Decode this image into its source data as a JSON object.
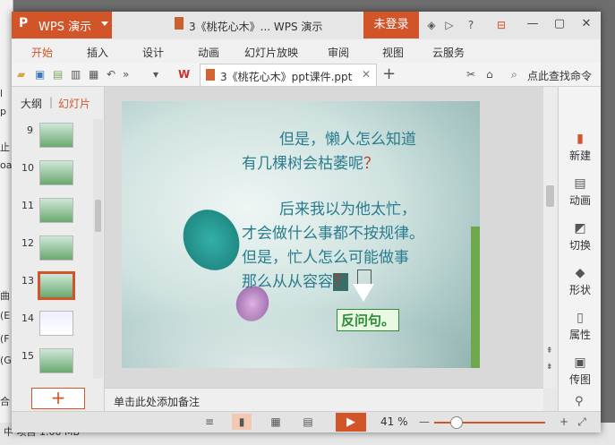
{
  "background": {
    "left_texts": [
      "l",
      "p",
      "止",
      "oad",
      "曲 (D",
      "(E",
      "(F",
      "(G",
      "中",
      "合"
    ],
    "bottom_text": "中    项目    1.00 MB"
  },
  "titlebar": {
    "app_name": "WPS 演示",
    "logo": "P",
    "doc_title": "3《桃花心木》... WPS 演示",
    "login": "未登录"
  },
  "menu": [
    "开始",
    "插入",
    "设计",
    "动画",
    "幻灯片放映",
    "审阅",
    "视图",
    "云服务"
  ],
  "toolbar": {
    "doc_tab": "3《桃花心木》ppt课件.ppt",
    "search": "点此查找命令"
  },
  "leftpane": {
    "tab_outline": "大纲",
    "tab_slides": "幻灯片",
    "slides": [
      "9",
      "10",
      "11",
      "12",
      "13",
      "14",
      "15"
    ],
    "selected": "13",
    "add": "+"
  },
  "slide": {
    "line1": "但是，懒人怎么知道",
    "line2": "有几棵树会枯萎呢",
    "line2_q": "？",
    "line3": "后来我以为他太忙，",
    "line4": "才会做什么事都不按规律。",
    "line5": "但是，忙人怎么可能做事",
    "line6": "那么从从容容",
    "line6_q": "？",
    "answer": "反问句。"
  },
  "notes": "单击此处添加备注",
  "rightpane": [
    "新建",
    "动画",
    "切换",
    "形状",
    "属性",
    "传图"
  ],
  "status": {
    "zoom": "41 %"
  },
  "colors": {
    "accent": "#d2552a",
    "slide_text": "#2a7d8e",
    "answer_green": "#2e8b3a"
  }
}
